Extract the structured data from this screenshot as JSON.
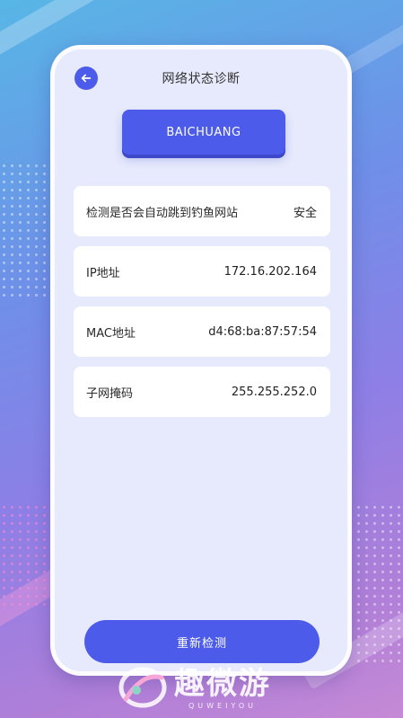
{
  "header": {
    "title": "网络状态诊断",
    "back_icon": "arrow-left-icon"
  },
  "device": {
    "name": "BAICHUANG"
  },
  "info_items": [
    {
      "label": "检测是否会自动跳到钓鱼网站",
      "value": "安全"
    },
    {
      "label": "IP地址",
      "value": "172.16.202.164"
    },
    {
      "label": "MAC地址",
      "value": "d4:68:ba:87:57:54"
    },
    {
      "label": "子网掩码",
      "value": "255.255.252.0"
    }
  ],
  "actions": {
    "retest_label": "重新检测"
  },
  "watermark": {
    "cn": "趣微游",
    "en": "QUWEIYOU"
  },
  "colors": {
    "accent": "#4c5bea",
    "card_bg": "#ffffff",
    "panel_bg": "#e7eafc"
  }
}
